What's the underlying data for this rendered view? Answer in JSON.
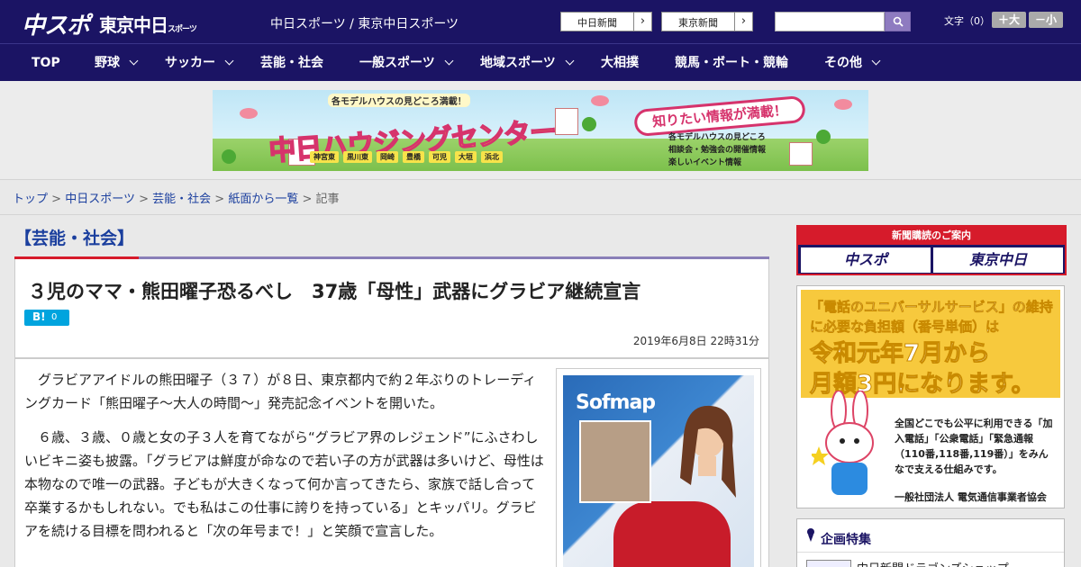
{
  "header": {
    "logo_chunichi": "中スポ",
    "logo_tokyo": "東京中日",
    "logo_tokyo_sub": "スポーツ",
    "site_title": "中日スポーツ / 東京中日スポーツ",
    "link_chunichi": "中日新聞",
    "link_tokyo": "東京新聞",
    "fontsize_label": "文字（0）",
    "fontsize_plus": "＋大",
    "fontsize_minus": "－小"
  },
  "nav": {
    "top": "TOP",
    "baseball": "野球",
    "soccer": "サッカー",
    "entertainment": "芸能・社会",
    "general_sports": "一般スポーツ",
    "regional_sports": "地域スポーツ",
    "sumo": "大相撲",
    "racing": "競馬・ボート・競輪",
    "other": "その他"
  },
  "banner": {
    "tagline": "各モデルハウスの見どころ満載！",
    "title": "中日ハウジングセンター",
    "badge": "知りたい情報が満載！",
    "info": [
      "各モデルハウスの見どころ",
      "相談会・勉強会の開催情報",
      "楽しいイベント情報"
    ],
    "cities": [
      "神宮東",
      "黒川東",
      "岡崎",
      "豊橋",
      "可児",
      "大垣",
      "浜北"
    ]
  },
  "breadcrumb": {
    "top": "トップ",
    "chunichi": "中日スポーツ",
    "entertainment": "芸能・社会",
    "paper": "紙面から一覧",
    "current": "記事",
    "sep": ">"
  },
  "article": {
    "section": "【芸能・社会】",
    "headline": "３児のママ・熊田曜子恐るべし　37歳「母性」武器にグラビア継続宣言",
    "hatena_label": "B!",
    "hatena_count": "0",
    "date": "2019年6月8日 22時31分",
    "paragraph1": "グラビアアイドルの熊田曜子（３７）が８日、東京都内で約２年ぶりのトレーディングカード「熊田曜子～大人の時間～」発売記念イベントを開いた。",
    "paragraph2": "６歳、３歳、０歳と女の子３人を育てながら“グラビア界のレジェンド”にふさわしいビキニ姿も披露。「グラビアは鮮度が命なので若い子の方が武器は多いけど、母性は本物なので唯一の武器。子どもが大きくなって何か言ってきたら、家族で話し合って卒業するかもしれない。でも私はこの仕事に誇りを持っている」とキッパリ。グラビアを続ける目標を問われると「次の年号まで！」と笑顔で宣言した。",
    "photo_sign": "Sofmap"
  },
  "sidebar": {
    "subscribe_head": "新聞購読のご案内",
    "subscribe_chunichi": "中スポ",
    "subscribe_tokyo": "東京中日",
    "ad_lead": "「電話のユニバーサルサービス」の維持に必要な負担額（番号単価）は",
    "ad_big1": "令和元年7月から",
    "ad_big2": "月額3円になります。",
    "ad_text": "全国どこでも公平に利用できる「加入電話」「公衆電話」「緊急通報（110番,118番,119番）」をみんなで支える仕組みです。",
    "ad_org": "一般社団法人 電気通信事業者協会",
    "feature_title": "企画特集",
    "feature_item": "中日新聞ドラゴンズショップ"
  },
  "colors": {
    "header_bg": "#1b1464",
    "accent_red": "#d61b2b",
    "link_blue": "#1b3f9e",
    "section_bar": "#8a7fb8",
    "hatena": "#00a4de"
  }
}
